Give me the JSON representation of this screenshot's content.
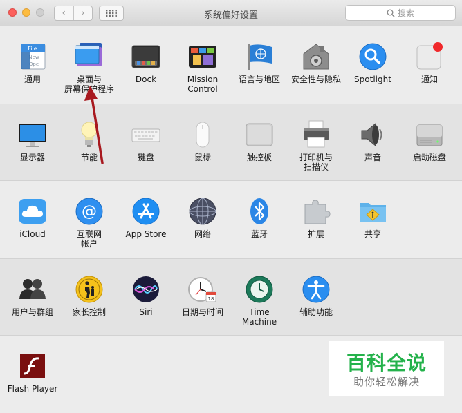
{
  "window": {
    "title": "系统偏好设置",
    "search_placeholder": "搜索",
    "nav_back": "‹",
    "nav_forward": "›"
  },
  "rows": [
    {
      "panes": [
        {
          "id": "general",
          "label": "通用",
          "icon": "general-icon"
        },
        {
          "id": "desktop",
          "label": "桌面与\n屏幕保护程序",
          "icon": "desktop-screensaver-icon"
        },
        {
          "id": "dock",
          "label": "Dock",
          "icon": "dock-icon"
        },
        {
          "id": "mission",
          "label": "Mission\nControl",
          "icon": "mission-control-icon"
        },
        {
          "id": "language",
          "label": "语言与地区",
          "icon": "language-region-flag-icon"
        },
        {
          "id": "security",
          "label": "安全性与隐私",
          "icon": "security-house-icon"
        },
        {
          "id": "spotlight",
          "label": "Spotlight",
          "icon": "spotlight-magnifier-icon"
        },
        {
          "id": "notifications",
          "label": "通知",
          "icon": "notifications-icon"
        }
      ]
    },
    {
      "panes": [
        {
          "id": "displays",
          "label": "显示器",
          "icon": "display-monitor-icon"
        },
        {
          "id": "energy",
          "label": "节能",
          "icon": "energy-bulb-icon"
        },
        {
          "id": "keyboard",
          "label": "键盘",
          "icon": "keyboard-icon"
        },
        {
          "id": "mouse",
          "label": "鼠标",
          "icon": "mouse-icon"
        },
        {
          "id": "trackpad",
          "label": "触控板",
          "icon": "trackpad-icon"
        },
        {
          "id": "printers",
          "label": "打印机与\n扫描仪",
          "icon": "printer-icon"
        },
        {
          "id": "sound",
          "label": "声音",
          "icon": "speaker-icon"
        },
        {
          "id": "startup",
          "label": "启动磁盘",
          "icon": "startup-disk-icon"
        }
      ]
    },
    {
      "panes": [
        {
          "id": "icloud",
          "label": "iCloud",
          "icon": "icloud-icon"
        },
        {
          "id": "internet",
          "label": "互联网\n帐户",
          "icon": "internet-accounts-at-icon"
        },
        {
          "id": "appstore",
          "label": "App Store",
          "icon": "app-store-icon"
        },
        {
          "id": "network",
          "label": "网络",
          "icon": "network-globe-icon"
        },
        {
          "id": "bluetooth",
          "label": "蓝牙",
          "icon": "bluetooth-icon"
        },
        {
          "id": "extensions",
          "label": "扩展",
          "icon": "extensions-puzzle-icon"
        },
        {
          "id": "sharing",
          "label": "共享",
          "icon": "sharing-folder-icon"
        }
      ]
    },
    {
      "panes": [
        {
          "id": "users",
          "label": "用户与群组",
          "icon": "users-groups-icon"
        },
        {
          "id": "parental",
          "label": "家长控制",
          "icon": "parental-controls-icon"
        },
        {
          "id": "siri",
          "label": "Siri",
          "icon": "siri-icon"
        },
        {
          "id": "datetime",
          "label": "日期与时间",
          "icon": "date-time-clock-icon"
        },
        {
          "id": "timemachine",
          "label": "Time Machine",
          "icon": "time-machine-icon"
        },
        {
          "id": "accessibility",
          "label": "辅助功能",
          "icon": "accessibility-icon"
        }
      ]
    },
    {
      "panes": [
        {
          "id": "flash",
          "label": "Flash Player",
          "icon": "flash-player-icon"
        }
      ]
    }
  ],
  "watermark": {
    "main": "百科全说",
    "sub": "助你轻松解决"
  },
  "colors": {
    "arrow": "#a8191f",
    "watermark_green": "#24b24b"
  }
}
